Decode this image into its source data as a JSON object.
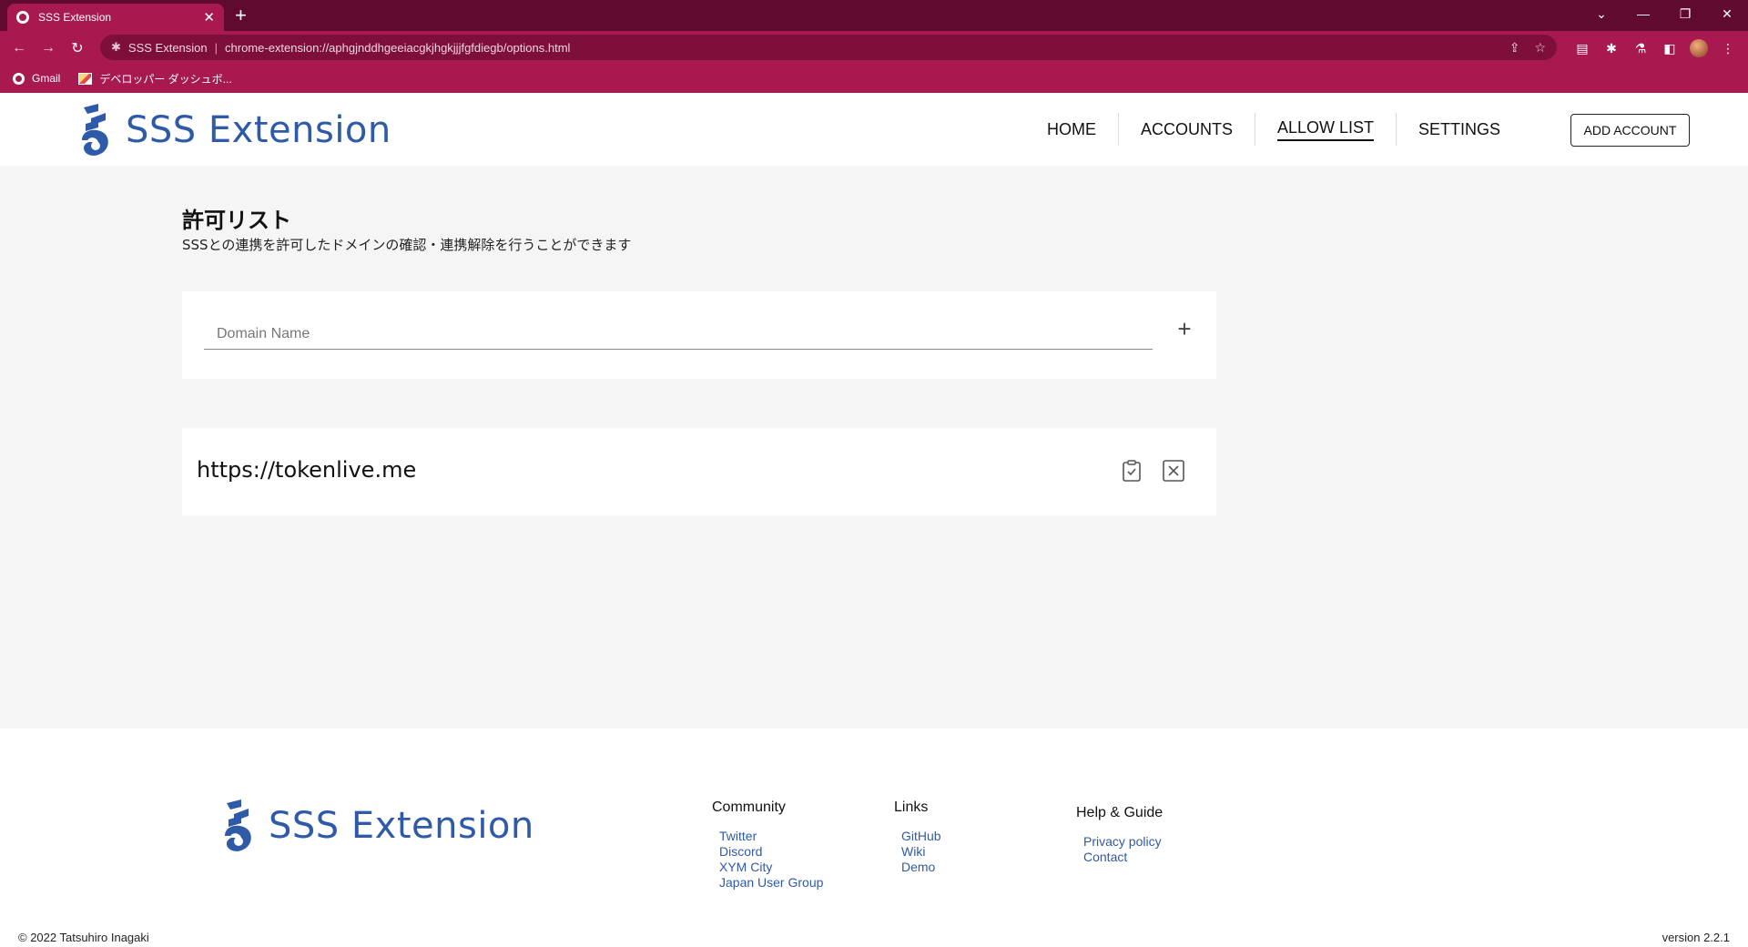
{
  "browser": {
    "tab_title": "SSS Extension",
    "tab_close": "✕",
    "new_tab": "+",
    "omnibox_site": "SSS Extension",
    "omnibox_separator": "|",
    "omnibox_url": "chrome-extension://aphgjnddhgeeiacgkjhgkjjjfgfdiegb/options.html",
    "bookmarks": [
      {
        "label": "Gmail",
        "icon": "globe-icon"
      },
      {
        "label": "デベロッパー ダッシュボ...",
        "icon": "image-icon"
      }
    ]
  },
  "header": {
    "logo_text": "SSS Extension",
    "nav": [
      {
        "label": "HOME"
      },
      {
        "label": "ACCOUNTS"
      },
      {
        "label": "ALLOW LIST",
        "active": true
      },
      {
        "label": "SETTINGS"
      }
    ],
    "add_account": "ADD ACCOUNT"
  },
  "main": {
    "title": "許可リスト",
    "description": "SSSとの連携を許可したドメインの確認・連携解除を行うことができます",
    "domain_input": {
      "placeholder": "Domain Name",
      "value": ""
    },
    "add_symbol": "+",
    "allowed_domains": [
      {
        "domain": "https://tokenlive.me"
      }
    ]
  },
  "footer": {
    "logo_text": "SSS Extension",
    "columns": [
      {
        "title": "Community",
        "links": [
          "Twitter",
          "Discord",
          "XYM City",
          "Japan User Group"
        ]
      },
      {
        "title": "Links",
        "links": [
          "GitHub",
          "Wiki",
          "Demo"
        ]
      },
      {
        "title": "Help & Guide",
        "links": [
          "Privacy policy",
          "Contact"
        ]
      }
    ],
    "copyright": "© 2022 Tatsuhiro Inagaki",
    "version": "version 2.2.1"
  },
  "colors": {
    "brand": "#2f5aa8",
    "browser_frame": "#a7194f",
    "browser_tabstrip": "#5f0a2e"
  }
}
